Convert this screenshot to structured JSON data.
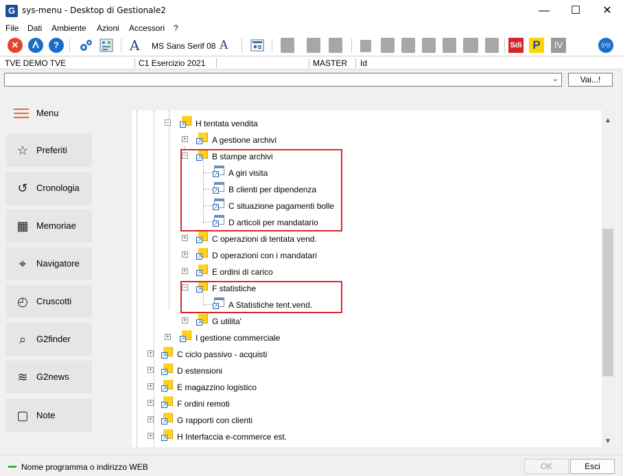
{
  "window": {
    "title": "sys-menu - Desktop di Gestionale2",
    "logo_letter": "G",
    "minimize": "—",
    "maximize": "☐",
    "close": "✕"
  },
  "menubar": [
    "File",
    "Dati",
    "Ambiente",
    "Azioni",
    "Accessori",
    "?"
  ],
  "toolbar": {
    "font_name": "MS Sans Serif 08",
    "font_glyph": "A",
    "font_size_glyph": "A",
    "help_glyph": "?",
    "close_glyph": "✕",
    "sdi_label": "Sdi",
    "p_label": "P",
    "iv_label": "IV",
    "radio_glyph": "((•))"
  },
  "context": {
    "company": "TVE DEMO TVE",
    "fiscal_year": "C1 Esercizio 2021",
    "user": "MASTER",
    "id": "Id"
  },
  "command": {
    "value": "",
    "caret": "⌄",
    "go_button": "Vai...!"
  },
  "sidebar": {
    "menu_label": "Menu",
    "items": [
      {
        "label": "Preferiti",
        "icon": "☆",
        "icon_name": "star-icon"
      },
      {
        "label": "Cronologia",
        "icon": "↺",
        "icon_name": "history-icon"
      },
      {
        "label": "Memoriae",
        "icon": "▦",
        "icon_name": "calendar-icon"
      },
      {
        "label": "Navigatore",
        "icon": "⌖",
        "icon_name": "map-icon"
      },
      {
        "label": "Cruscotti",
        "icon": "◴",
        "icon_name": "gauge-icon"
      },
      {
        "label": "G2finder",
        "icon": "⌕",
        "icon_name": "search-icon"
      },
      {
        "label": "G2news",
        "icon": "≋",
        "icon_name": "rss-icon"
      },
      {
        "label": "Note",
        "icon": "▢",
        "icon_name": "note-icon"
      }
    ]
  },
  "tree": {
    "rows": [
      {
        "label": "H tentata vendita",
        "type": "folder",
        "state": "open"
      },
      {
        "label": "A gestione archivi",
        "type": "folder",
        "state": "closed"
      },
      {
        "label": "B stampe archivi",
        "type": "folder",
        "state": "open"
      },
      {
        "label": "A giri visita",
        "type": "program"
      },
      {
        "label": "B clienti per dipendenza",
        "type": "program"
      },
      {
        "label": "C situazione pagamenti bolle",
        "type": "program"
      },
      {
        "label": "D articoli per mandatario",
        "type": "program"
      },
      {
        "label": "C operazioni di tentata vend.",
        "type": "folder",
        "state": "closed"
      },
      {
        "label": "D operazioni con i mandatari",
        "type": "folder",
        "state": "closed"
      },
      {
        "label": "E ordini di carico",
        "type": "folder",
        "state": "closed"
      },
      {
        "label": "F statistiche",
        "type": "folder",
        "state": "open"
      },
      {
        "label": "A Statistiche tent.vend.",
        "type": "program"
      },
      {
        "label": "G utilita'",
        "type": "folder",
        "state": "closed"
      },
      {
        "label": "I gestione commerciale",
        "type": "folder",
        "state": "closed"
      },
      {
        "label": "C ciclo passivo - acquisti",
        "type": "folder",
        "state": "closed"
      },
      {
        "label": "D estensioni",
        "type": "folder",
        "state": "closed"
      },
      {
        "label": "E magazzino logistico",
        "type": "folder",
        "state": "closed"
      },
      {
        "label": "F ordini remoti",
        "type": "folder",
        "state": "closed"
      },
      {
        "label": "G rapporti con clienti",
        "type": "folder",
        "state": "closed"
      },
      {
        "label": "H Interfaccia e-commerce est.",
        "type": "folder",
        "state": "closed"
      }
    ],
    "expand_glyph": "+",
    "collapse_glyph": "−",
    "shortcut_glyph": "↗"
  },
  "scrollbar": {
    "up": "▲",
    "down": "▼"
  },
  "footer": {
    "hint": "Nome programma o indirizzo WEB",
    "ok_button": "OK",
    "exit_button": "Esci"
  },
  "colors": {
    "highlight_box": "#d9252b",
    "accent_orange": "#e96a2b",
    "status_led": "#22c11f"
  }
}
